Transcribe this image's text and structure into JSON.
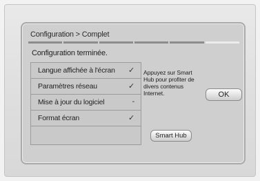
{
  "dialog": {
    "title": "Configuration > Complet",
    "progress_steps": 6,
    "progress_current": 6,
    "subtitle": "Configuration terminée."
  },
  "steps": [
    {
      "label": "Langue affichée à l'écran",
      "status": "✓"
    },
    {
      "label": "Paramètres réseau",
      "status": "✓"
    },
    {
      "label": "Mise à jour du logiciel",
      "status": "-"
    },
    {
      "label": "Format écran",
      "status": "✓"
    },
    {
      "label": "",
      "status": ""
    }
  ],
  "info_text": "Appuyez sur Smart Hub pour profiter de divers contenus Internet.",
  "buttons": {
    "ok_label": "OK",
    "smart_hub_label": "Smart Hub"
  }
}
